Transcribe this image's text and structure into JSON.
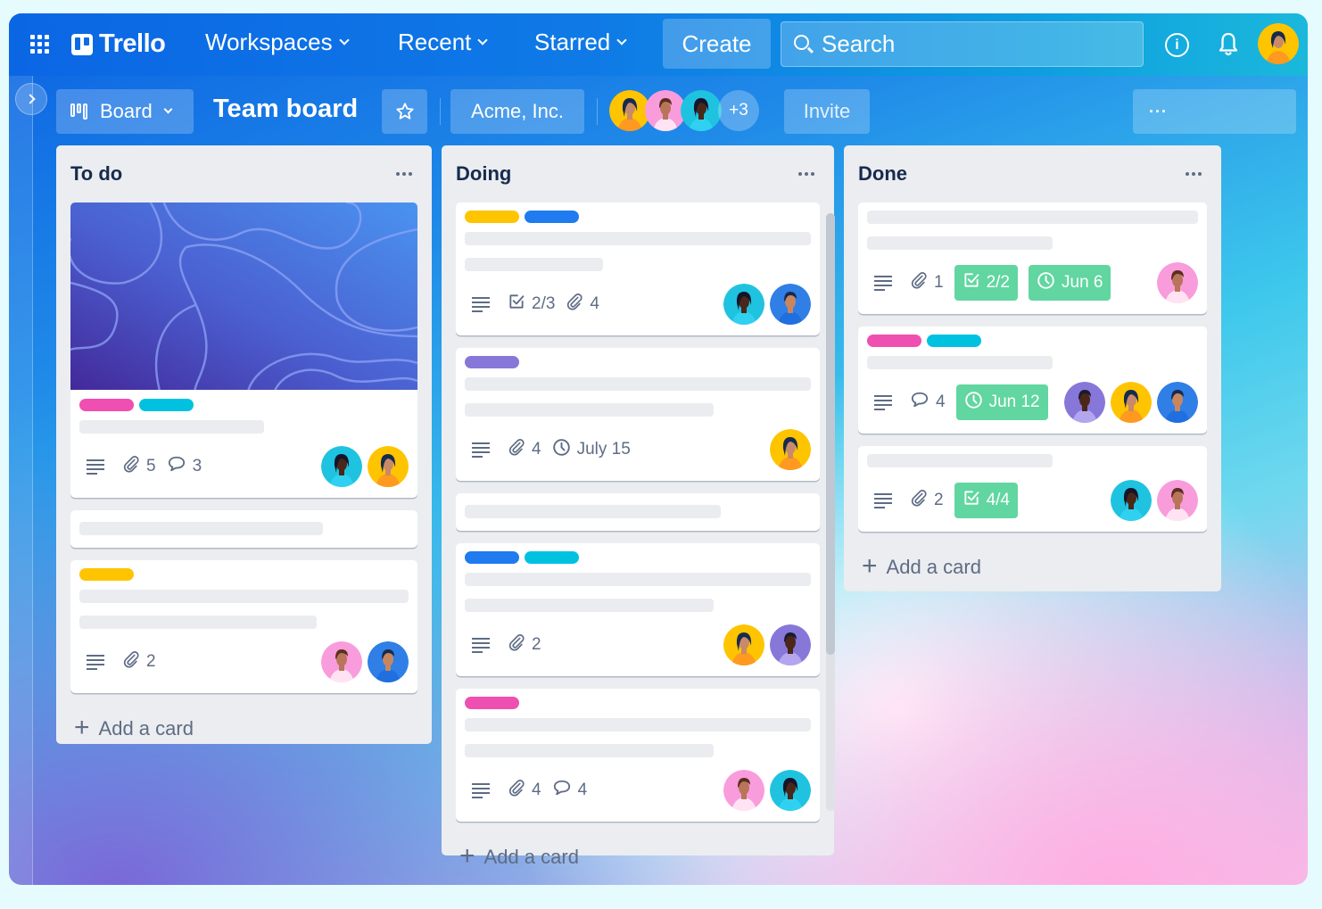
{
  "nav": {
    "app_name": "Trello",
    "menus": [
      "Workspaces",
      "Recent",
      "Starred"
    ],
    "create_label": "Create",
    "search_placeholder": "Search",
    "info_label": "i"
  },
  "board": {
    "view_label": "Board",
    "title": "Team board",
    "workspace": "Acme, Inc.",
    "extra_members": "+3",
    "invite_label": "Invite",
    "menu_label": "···"
  },
  "colors": {
    "pink": "#ef4fb1",
    "cyan": "#00c2e0",
    "yellow": "#ffc400",
    "blue": "#1f7bef",
    "purple": "#8777d9",
    "green_badge": "#61d6a0"
  },
  "lists": [
    {
      "title": "To do",
      "add_label": "Add a card",
      "cards": [
        {
          "cover": true,
          "labels": [
            "pink",
            "cyan"
          ],
          "attachments": "5",
          "comments": "3",
          "members": [
            "teal-woman",
            "yellow-woman"
          ]
        },
        {
          "members": []
        },
        {
          "labels": [
            "yellow"
          ],
          "attachments": "2",
          "members": [
            "pink-man",
            "blue-man"
          ]
        }
      ]
    },
    {
      "title": "Doing",
      "add_label": "Add a card",
      "cards": [
        {
          "labels": [
            "yellow",
            "blue"
          ],
          "checklist": "2/3",
          "attachments": "4",
          "members": [
            "teal-woman",
            "blue-man"
          ]
        },
        {
          "labels": [
            "purple"
          ],
          "attachments": "4",
          "due": "July 15",
          "members": [
            "yellow-woman"
          ]
        },
        {
          "members": []
        },
        {
          "labels": [
            "blue",
            "cyan"
          ],
          "attachments": "2",
          "members": [
            "yellow-woman",
            "purple-man"
          ]
        },
        {
          "labels": [
            "pink"
          ],
          "attachments": "4",
          "comments": "4",
          "members": [
            "pink-man",
            "teal-woman"
          ]
        }
      ]
    },
    {
      "title": "Done",
      "add_label": "Add a card",
      "cards": [
        {
          "attachments": "1",
          "checklist_done": "2/2",
          "due_done": "Jun 6",
          "members": [
            "pink-man"
          ]
        },
        {
          "labels": [
            "pink",
            "cyan"
          ],
          "comments": "4",
          "due_done": "Jun 12",
          "members": [
            "purple-man",
            "yellow-woman",
            "blue-man"
          ]
        },
        {
          "attachments": "2",
          "checklist_done": "4/4",
          "members": [
            "teal-woman",
            "pink-man"
          ]
        }
      ]
    }
  ]
}
